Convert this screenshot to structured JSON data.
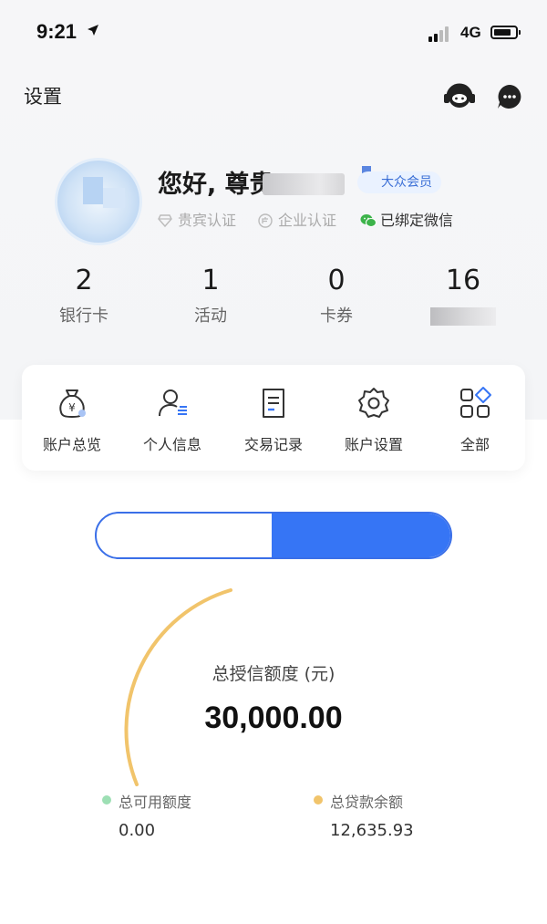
{
  "status_bar": {
    "time": "9:21",
    "network": "4G"
  },
  "header": {
    "settings_label": "设置"
  },
  "profile": {
    "greeting": "您好, 尊贵",
    "member_badge": "大众会员",
    "vip_cert": "贵宾认证",
    "enterprise_cert": "企业认证",
    "wechat_status": "已绑定微信"
  },
  "stats": [
    {
      "value": "2",
      "label": "银行卡"
    },
    {
      "value": "1",
      "label": "活动"
    },
    {
      "value": "0",
      "label": "卡券"
    },
    {
      "value": "16",
      "label": ""
    }
  ],
  "menu": [
    {
      "label": "账户总览",
      "icon": "money-bag-icon"
    },
    {
      "label": "个人信息",
      "icon": "person-info-icon"
    },
    {
      "label": "交易记录",
      "icon": "document-icon"
    },
    {
      "label": "账户设置",
      "icon": "gear-icon"
    },
    {
      "label": "全部",
      "icon": "all-apps-icon"
    }
  ],
  "credit": {
    "title": "总授信额度 (元)",
    "total": "30,000.00",
    "available_label": "总可用额度",
    "available_value": "0.00",
    "loan_label": "总贷款余额",
    "loan_value": "12,635.93"
  },
  "colors": {
    "accent": "#3675f5",
    "available_dot": "#9ddfb4",
    "loan_dot": "#f1c46b"
  }
}
